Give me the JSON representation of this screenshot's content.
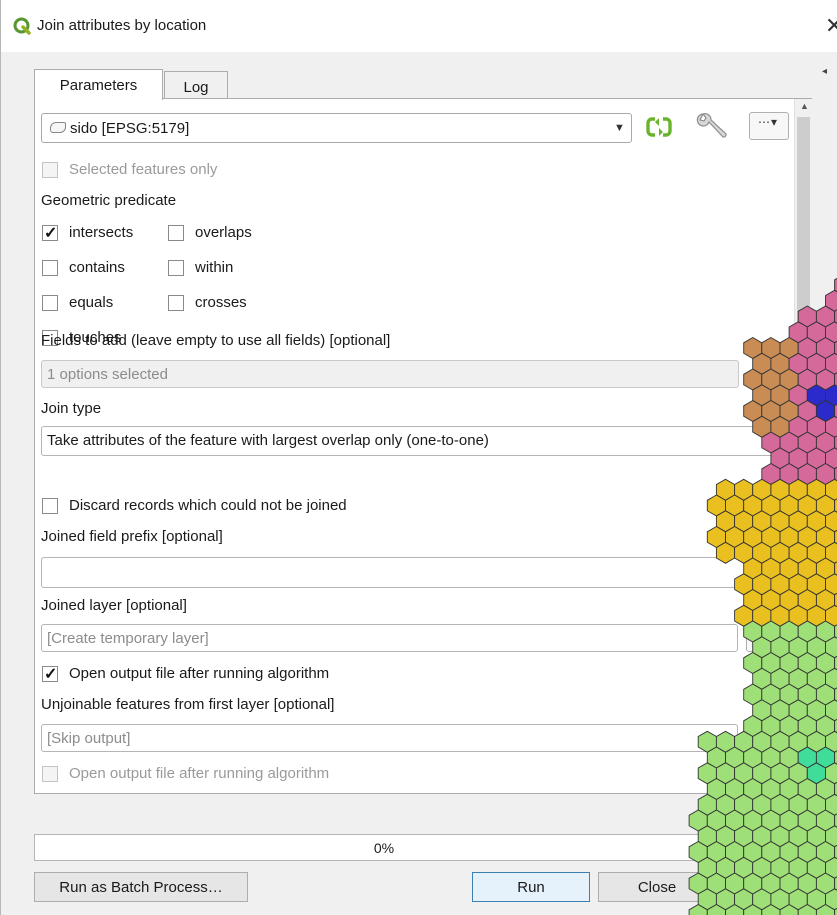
{
  "window": {
    "title": "Join attributes by location",
    "close_glyph": "✕"
  },
  "tabs": [
    {
      "label": "Parameters",
      "active": true
    },
    {
      "label": "Log",
      "active": false
    }
  ],
  "input_layer": {
    "value": "sido [EPSG:5179]",
    "icon": "polygon-layer-icon"
  },
  "selected_only": {
    "label": "Selected features only",
    "checked": false,
    "enabled": false
  },
  "predicate": {
    "heading": "Geometric predicate",
    "options": [
      {
        "label": "intersects",
        "checked": true
      },
      {
        "label": "overlaps",
        "checked": false
      },
      {
        "label": "contains",
        "checked": false
      },
      {
        "label": "within",
        "checked": false
      },
      {
        "label": "equals",
        "checked": false
      },
      {
        "label": "crosses",
        "checked": false
      },
      {
        "label": "touches",
        "checked": false
      }
    ]
  },
  "fields_to_add": {
    "label": "Fields to add (leave empty to use all fields) [optional]",
    "value": "1 options selected"
  },
  "join_type": {
    "label": "Join type",
    "value": "Take attributes of the feature with largest overlap only (one-to-one)"
  },
  "discard": {
    "label": "Discard records which could not be joined",
    "checked": false
  },
  "prefix": {
    "label": "Joined field prefix [optional]",
    "value": ""
  },
  "joined_layer": {
    "label": "Joined layer [optional]",
    "placeholder": "[Create temporary layer]"
  },
  "open_joined": {
    "label": "Open output file after running algorithm",
    "checked": true
  },
  "unjoinable": {
    "label": "Unjoinable features from first layer [optional]",
    "placeholder": "[Skip output]"
  },
  "open_unjoinable": {
    "label": "Open output file after running algorithm",
    "checked": false,
    "enabled": false
  },
  "progress": {
    "text": "0%",
    "value": 0
  },
  "buttons": {
    "batch": "Run as Batch Process…",
    "run": "Run",
    "close": "Close",
    "more": "…"
  },
  "map_colors": {
    "pink": "#d4699a",
    "brown": "#c98c55",
    "blue": "#2b2bcc",
    "yellow": "#e9c020",
    "green": "#9ee077",
    "teal": "#3fdc9a"
  }
}
